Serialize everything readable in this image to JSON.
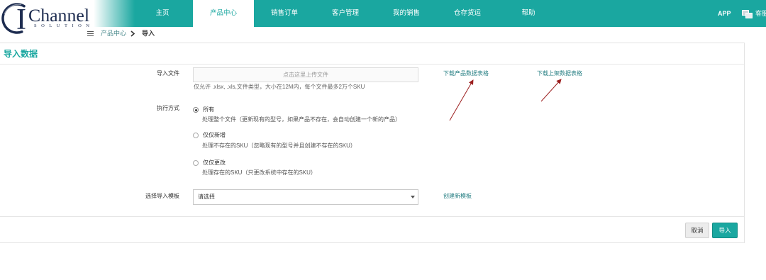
{
  "header": {
    "logo": {
      "initial": "I",
      "name": "Channel",
      "tagline": "SOLUTION"
    },
    "nav": [
      {
        "label": "主页",
        "active": false
      },
      {
        "label": "产品中心",
        "active": true
      },
      {
        "label": "销售订单",
        "active": false
      },
      {
        "label": "客户管理",
        "active": false
      },
      {
        "label": "我的销售",
        "active": false
      },
      {
        "label": "仓存货运",
        "active": false
      },
      {
        "label": "帮助",
        "active": false
      }
    ],
    "app_label": "APP",
    "service_label": "客服"
  },
  "breadcrumb": {
    "items": [
      "产品中心",
      "导入"
    ]
  },
  "panel": {
    "title": "导入数据",
    "file_row": {
      "label": "导入文件",
      "placeholder": "点击这里上传文件",
      "hint": "仅允许 .xlsx, .xls,文件类型，大小在12M内，每个文件最多2万个SKU",
      "links": [
        "下载产品数据表格",
        "下载上架数据表格"
      ]
    },
    "mode_row": {
      "label": "执行方式",
      "options": [
        {
          "label": "所有",
          "desc": "处理整个文件（更新现有的型号，如果产品不存在，会自动创建一个新的产品）",
          "selected": true
        },
        {
          "label": "仅仅新增",
          "desc": "处理不存在的SKU（忽略现有的型号并且创建不存在的SKU）",
          "selected": false
        },
        {
          "label": "仅仅更改",
          "desc": "处理存在的SKU（只更改系统中存在的SKU）",
          "selected": false
        }
      ]
    },
    "template_row": {
      "label": "选择导入模板",
      "selected": "请选择",
      "link": "创建新模板"
    },
    "actions": {
      "cancel": "取消",
      "submit": "导入"
    }
  },
  "icons": {
    "breadcrumb_menu": "menu-icon",
    "breadcrumb_separator": "chevron-right-icon",
    "service": "chat-icon",
    "select_arrow": "caret-down-icon",
    "annotation": "arrow-annotation"
  },
  "colors": {
    "accent": "#1aa7a0",
    "link": "#2a8185",
    "annotation": "#9c1f1f",
    "logo": "#1c2b4f"
  }
}
